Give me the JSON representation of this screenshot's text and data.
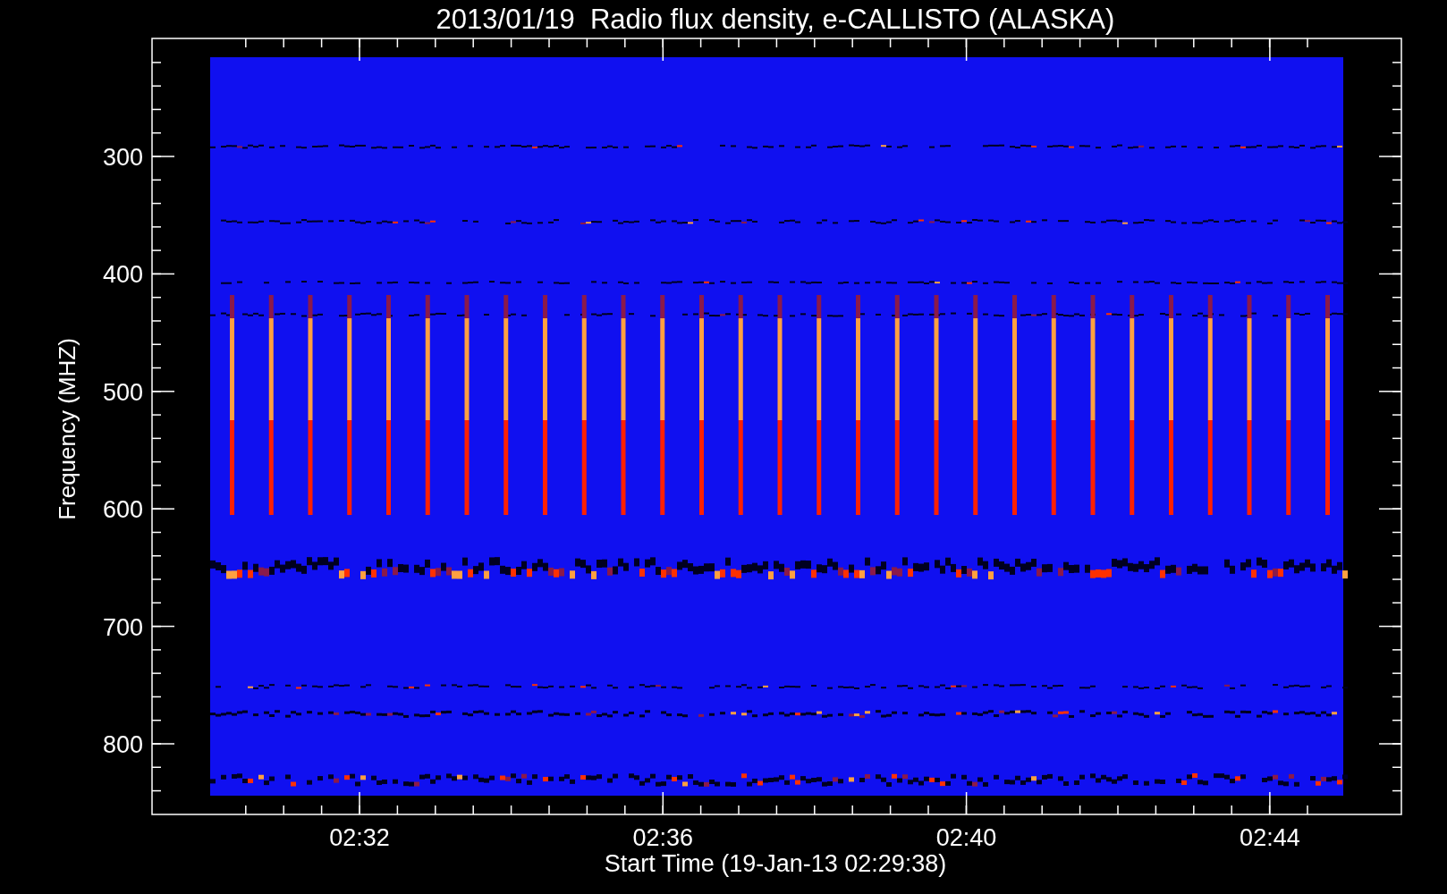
{
  "title": "2013/01/19  Radio flux density, e-CALLISTO (ALASKA)",
  "y_axis": {
    "label": "Frequency (MHZ)",
    "ticks": [
      "300",
      "400",
      "500",
      "600",
      "700",
      "800"
    ]
  },
  "x_axis": {
    "label": "Start Time (19-Jan-13 02:29:38)",
    "ticks": [
      "02:32",
      "02:36",
      "02:40",
      "02:44"
    ]
  }
}
